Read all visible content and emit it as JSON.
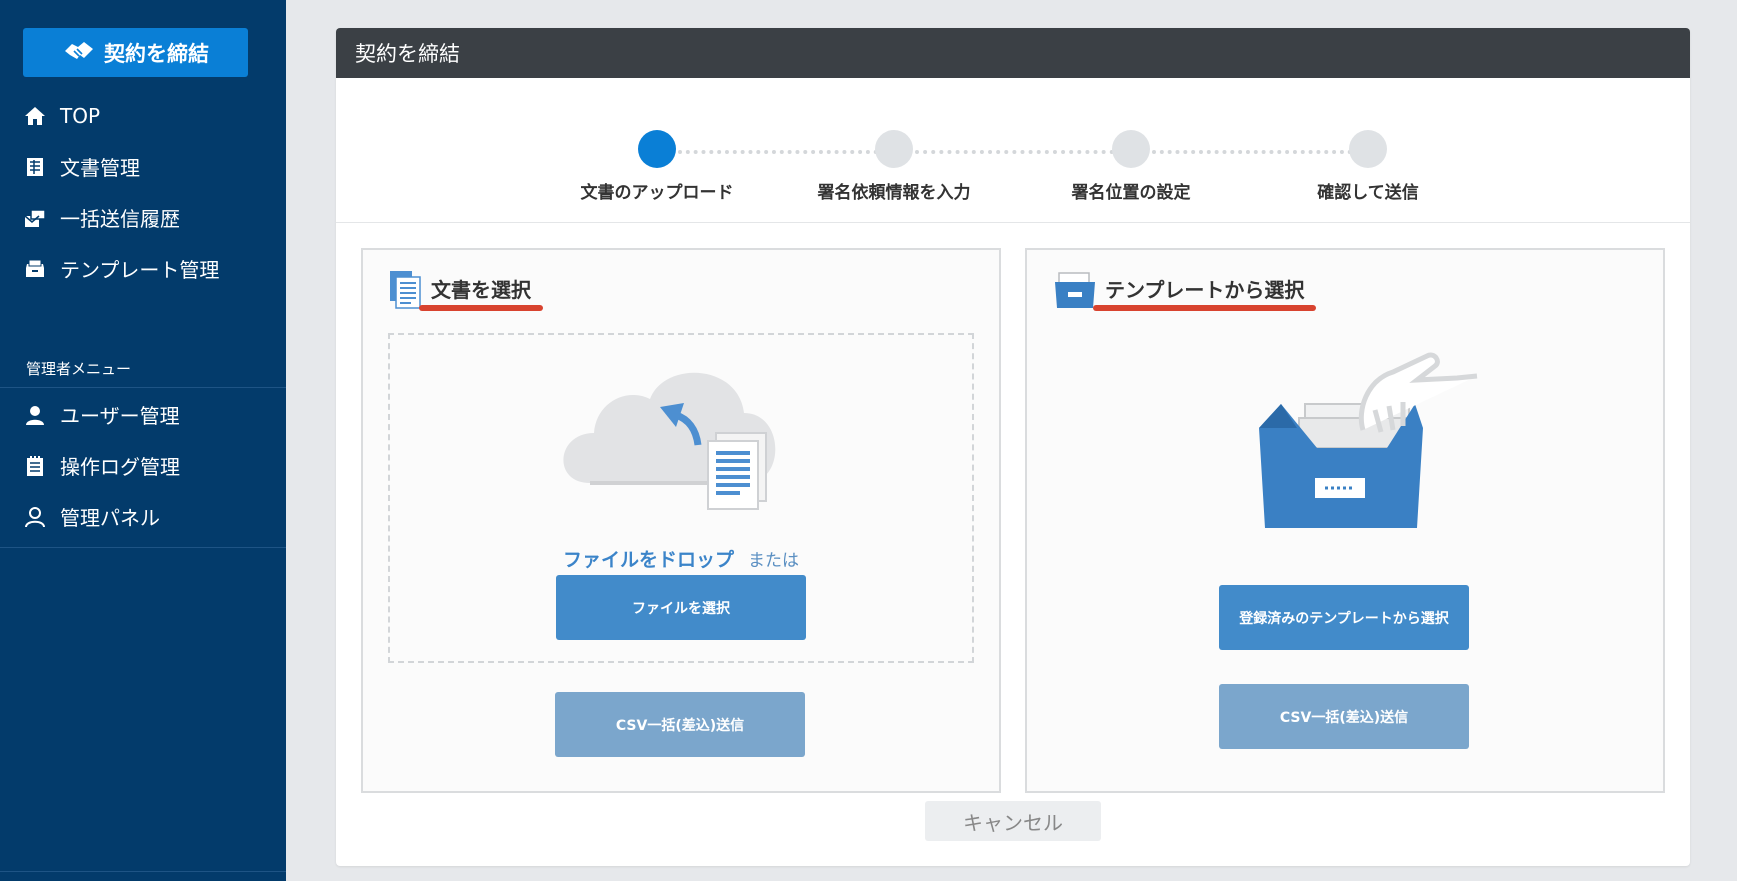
{
  "sidebar": {
    "sign_button": "契約を締結",
    "items": [
      {
        "label": "TOP"
      },
      {
        "label": "文書管理"
      },
      {
        "label": "一括送信履歴"
      },
      {
        "label": "テンプレート管理"
      }
    ],
    "admin_title": "管理者メニュー",
    "admin_items": [
      {
        "label": "ユーザー管理"
      },
      {
        "label": "操作ログ管理"
      },
      {
        "label": "管理パネル"
      }
    ]
  },
  "panel": {
    "title": "契約を締結"
  },
  "steps": [
    {
      "label": "文書のアップロード",
      "active": true
    },
    {
      "label": "署名依頼情報を入力",
      "active": false
    },
    {
      "label": "署名位置の設定",
      "active": false
    },
    {
      "label": "確認して送信",
      "active": false
    }
  ],
  "left_card": {
    "title": "文書を選択",
    "drop_text": "ファイルをドロップ",
    "or_text": "または",
    "select_file_button": "ファイルを選択",
    "csv_button": "CSV一括(差込)送信"
  },
  "right_card": {
    "title": "テンプレートから選択",
    "select_template_button": "登録済みのテンプレートから選択",
    "csv_button": "CSV一括(差込)送信"
  },
  "cancel_button": "キャンセル",
  "colors": {
    "sidebar_bg": "#033b6b",
    "accent": "#0a7fd6",
    "primary_button": "#428bca",
    "secondary_button": "#7ba6cc",
    "underline": "#d8432f",
    "header_bg": "#3b4045"
  }
}
